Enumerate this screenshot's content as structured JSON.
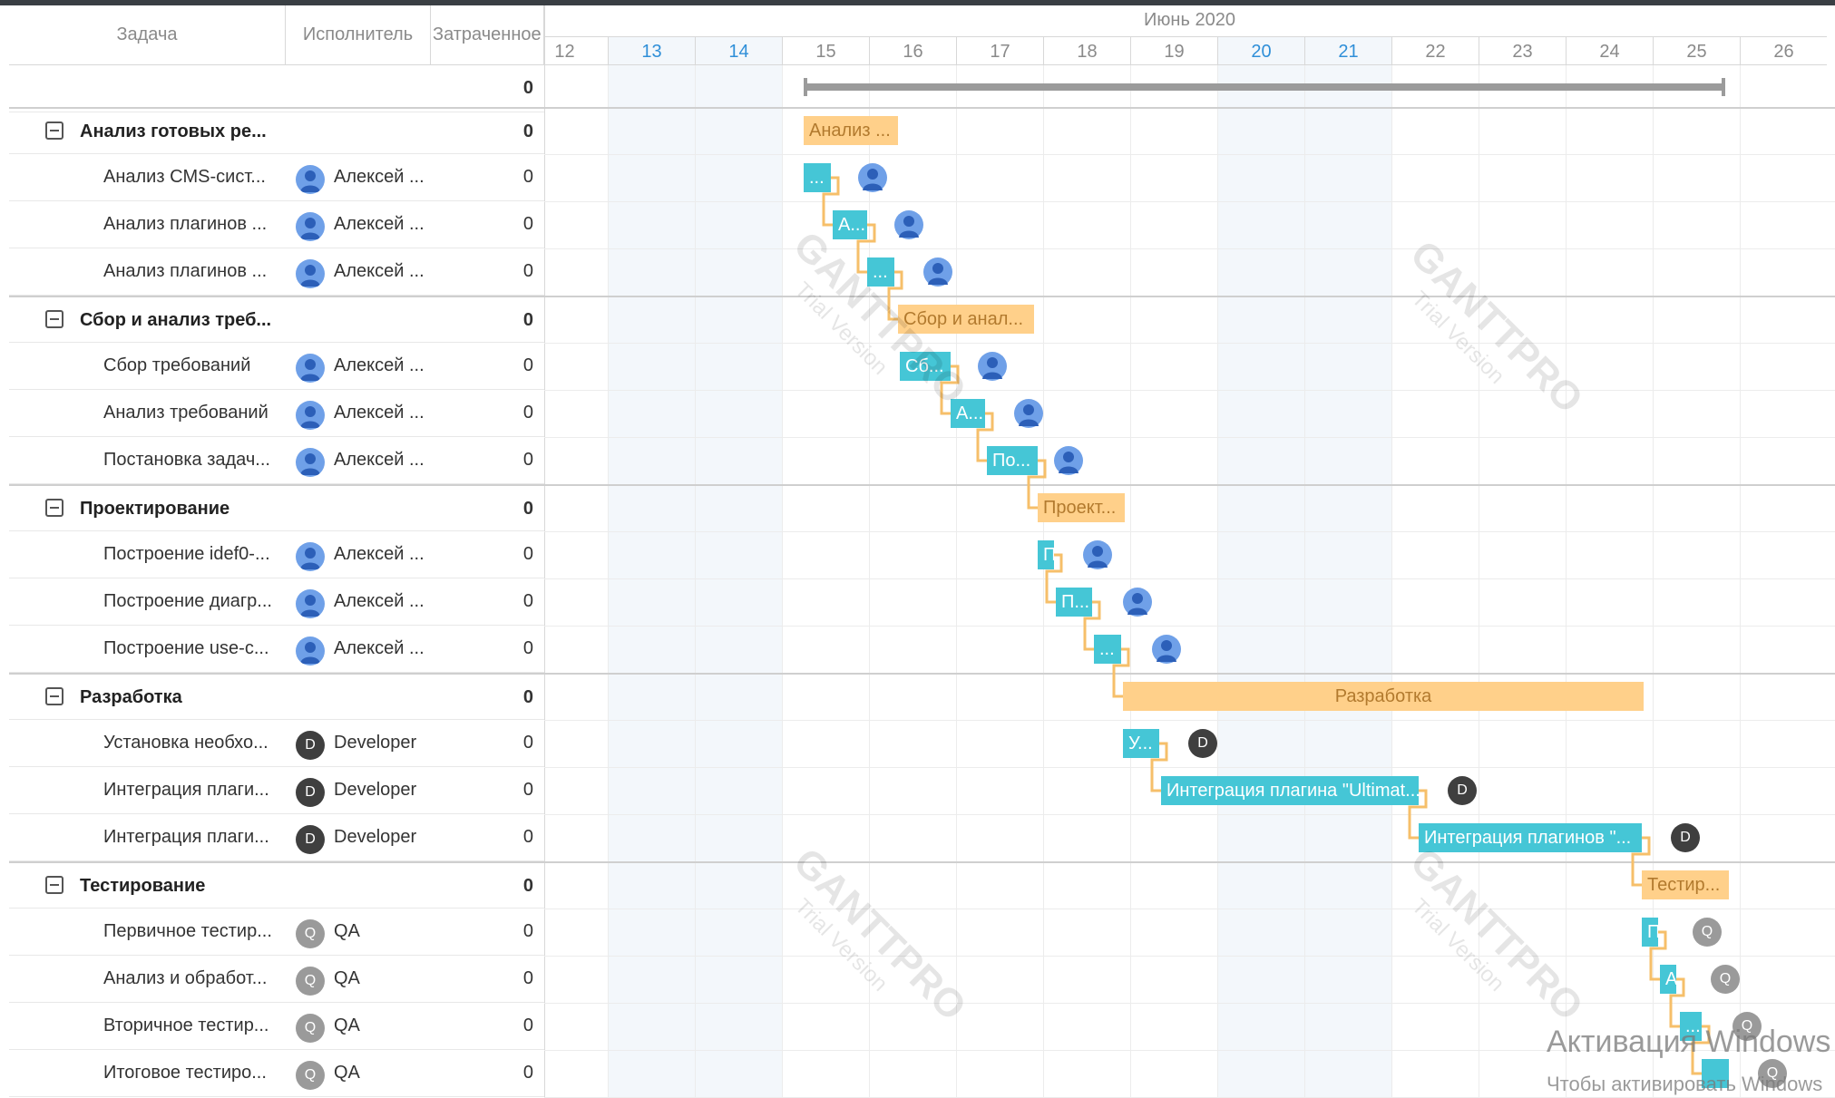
{
  "header": {
    "col_task": "Задача",
    "col_assignee": "Исполнитель",
    "col_spent": "Затраченное"
  },
  "timeline": {
    "month": "Июнь 2020",
    "days": [
      "12",
      "13",
      "14",
      "15",
      "16",
      "17",
      "18",
      "19",
      "20",
      "21",
      "22",
      "23",
      "24",
      "25",
      "26"
    ],
    "weekend_days": [
      "13",
      "14",
      "20",
      "21"
    ]
  },
  "total": {
    "spent": "0"
  },
  "rows": [
    {
      "type": "group",
      "name": "Анализ готовых ре...",
      "spent": "0"
    },
    {
      "type": "task",
      "name": "Анализ CMS-сист...",
      "assignee": "Алексей ...",
      "avatar": "person",
      "spent": "0"
    },
    {
      "type": "task",
      "name": "Анализ плагинов ...",
      "assignee": "Алексей ...",
      "avatar": "person",
      "spent": "0"
    },
    {
      "type": "task",
      "name": "Анализ плагинов ...",
      "assignee": "Алексей ...",
      "avatar": "person",
      "spent": "0"
    },
    {
      "type": "group",
      "name": "Сбор и анализ треб...",
      "spent": "0"
    },
    {
      "type": "task",
      "name": "Сбор требований",
      "assignee": "Алексей ...",
      "avatar": "person",
      "spent": "0"
    },
    {
      "type": "task",
      "name": "Анализ требований",
      "assignee": "Алексей ...",
      "avatar": "person",
      "spent": "0"
    },
    {
      "type": "task",
      "name": "Постановка задач...",
      "assignee": "Алексей ...",
      "avatar": "person",
      "spent": "0"
    },
    {
      "type": "group",
      "name": "Проектирование",
      "spent": "0"
    },
    {
      "type": "task",
      "name": "Построение idef0-...",
      "assignee": "Алексей ...",
      "avatar": "person",
      "spent": "0"
    },
    {
      "type": "task",
      "name": "Построение диагр...",
      "assignee": "Алексей ...",
      "avatar": "person",
      "spent": "0"
    },
    {
      "type": "task",
      "name": "Построение use-c...",
      "assignee": "Алексей ...",
      "avatar": "person",
      "spent": "0"
    },
    {
      "type": "group",
      "name": "Разработка",
      "spent": "0"
    },
    {
      "type": "task",
      "name": "Установка необхо...",
      "assignee": "Developer",
      "avatar": "dev",
      "initial": "D",
      "spent": "0"
    },
    {
      "type": "task",
      "name": "Интеграция плаги...",
      "assignee": "Developer",
      "avatar": "dev",
      "initial": "D",
      "spent": "0"
    },
    {
      "type": "task",
      "name": "Интеграция плаги...",
      "assignee": "Developer",
      "avatar": "dev",
      "initial": "D",
      "spent": "0"
    },
    {
      "type": "group",
      "name": "Тестирование",
      "spent": "0"
    },
    {
      "type": "task",
      "name": "Первичное тестир...",
      "assignee": "QA",
      "avatar": "qa",
      "initial": "Q",
      "spent": "0"
    },
    {
      "type": "task",
      "name": "Анализ и обработ...",
      "assignee": "QA",
      "avatar": "qa",
      "initial": "Q",
      "spent": "0"
    },
    {
      "type": "task",
      "name": "Вторичное тестир...",
      "assignee": "QA",
      "avatar": "qa",
      "initial": "Q",
      "spent": "0"
    },
    {
      "type": "task",
      "name": "Итоговое тестиро...",
      "assignee": "QA",
      "avatar": "qa",
      "initial": "Q",
      "spent": "0"
    }
  ],
  "bar_labels": [
    "Анализ ...",
    "...",
    "А...",
    "...",
    "Сбор и анал...",
    "Сб...",
    "А...",
    "По...",
    "Проект...",
    "П",
    "П...",
    "...",
    "Разработка",
    "У...",
    "Интеграция плагина \"Ultimat...",
    "Интеграция плагинов \"...",
    "Тестир...",
    "П",
    "А",
    "...",
    ""
  ],
  "watermark": {
    "brand": "GANTTPRO",
    "trial": "Trial Version"
  },
  "activation": {
    "line1": "Активация Windows",
    "line2": "Чтобы активировать Windows"
  },
  "colors": {
    "group_bar": "#ffd08a",
    "task_bar": "#45c6d6",
    "weekend": "#f3f7fb",
    "weekend_text": "#2f8fd8",
    "link": "#f6bf6a"
  }
}
